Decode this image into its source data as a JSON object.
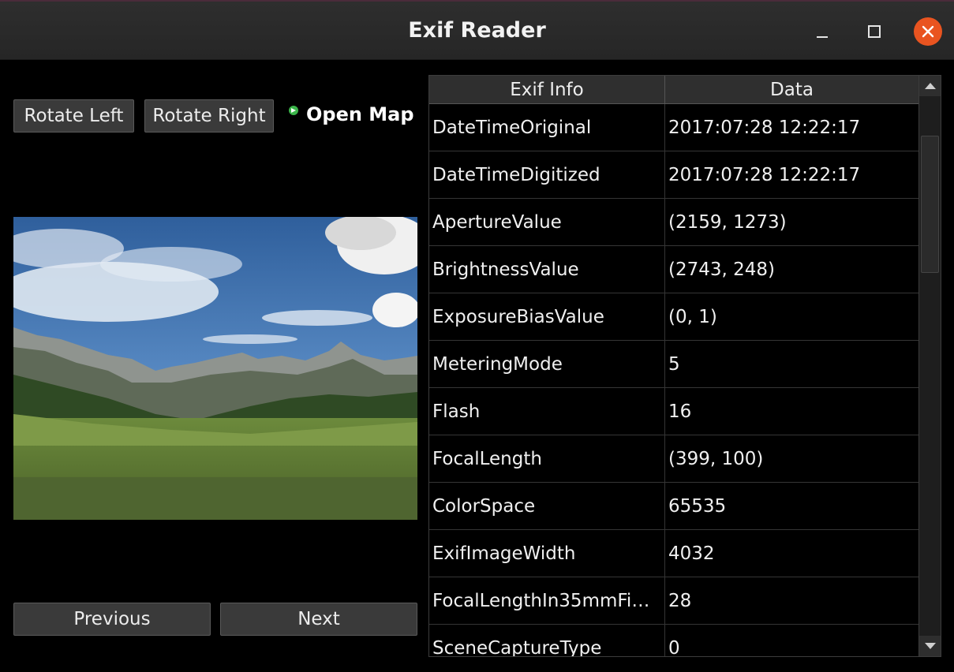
{
  "window": {
    "title": "Exif Reader"
  },
  "toolbar": {
    "rotate_left_label": "Rotate Left",
    "rotate_right_label": "Rotate Right",
    "open_map_label": "Open Map"
  },
  "navigation": {
    "previous_label": "Previous",
    "next_label": "Next"
  },
  "table": {
    "headers": [
      "Exif Info",
      "Data"
    ],
    "rows": [
      {
        "key": "DateTimeOriginal",
        "value": "2017:07:28 12:22:17"
      },
      {
        "key": "DateTimeDigitized",
        "value": "2017:07:28 12:22:17"
      },
      {
        "key": "ApertureValue",
        "value": "(2159, 1273)"
      },
      {
        "key": "BrightnessValue",
        "value": "(2743, 248)"
      },
      {
        "key": "ExposureBiasValue",
        "value": "(0, 1)"
      },
      {
        "key": "MeteringMode",
        "value": "5"
      },
      {
        "key": "Flash",
        "value": "16"
      },
      {
        "key": "FocalLength",
        "value": "(399, 100)"
      },
      {
        "key": "ColorSpace",
        "value": "65535"
      },
      {
        "key": "ExifImageWidth",
        "value": "4032"
      },
      {
        "key": "FocalLengthIn35mmFi…",
        "value": "28"
      },
      {
        "key": "SceneCaptureType",
        "value": "0"
      }
    ]
  },
  "colors": {
    "close_button": "#e95420",
    "open_map_icon": "#3bb54a"
  },
  "icons": {
    "minimize": "minimize-icon",
    "maximize": "maximize-icon",
    "close": "close-icon",
    "open_map": "arrow-right-icon"
  }
}
